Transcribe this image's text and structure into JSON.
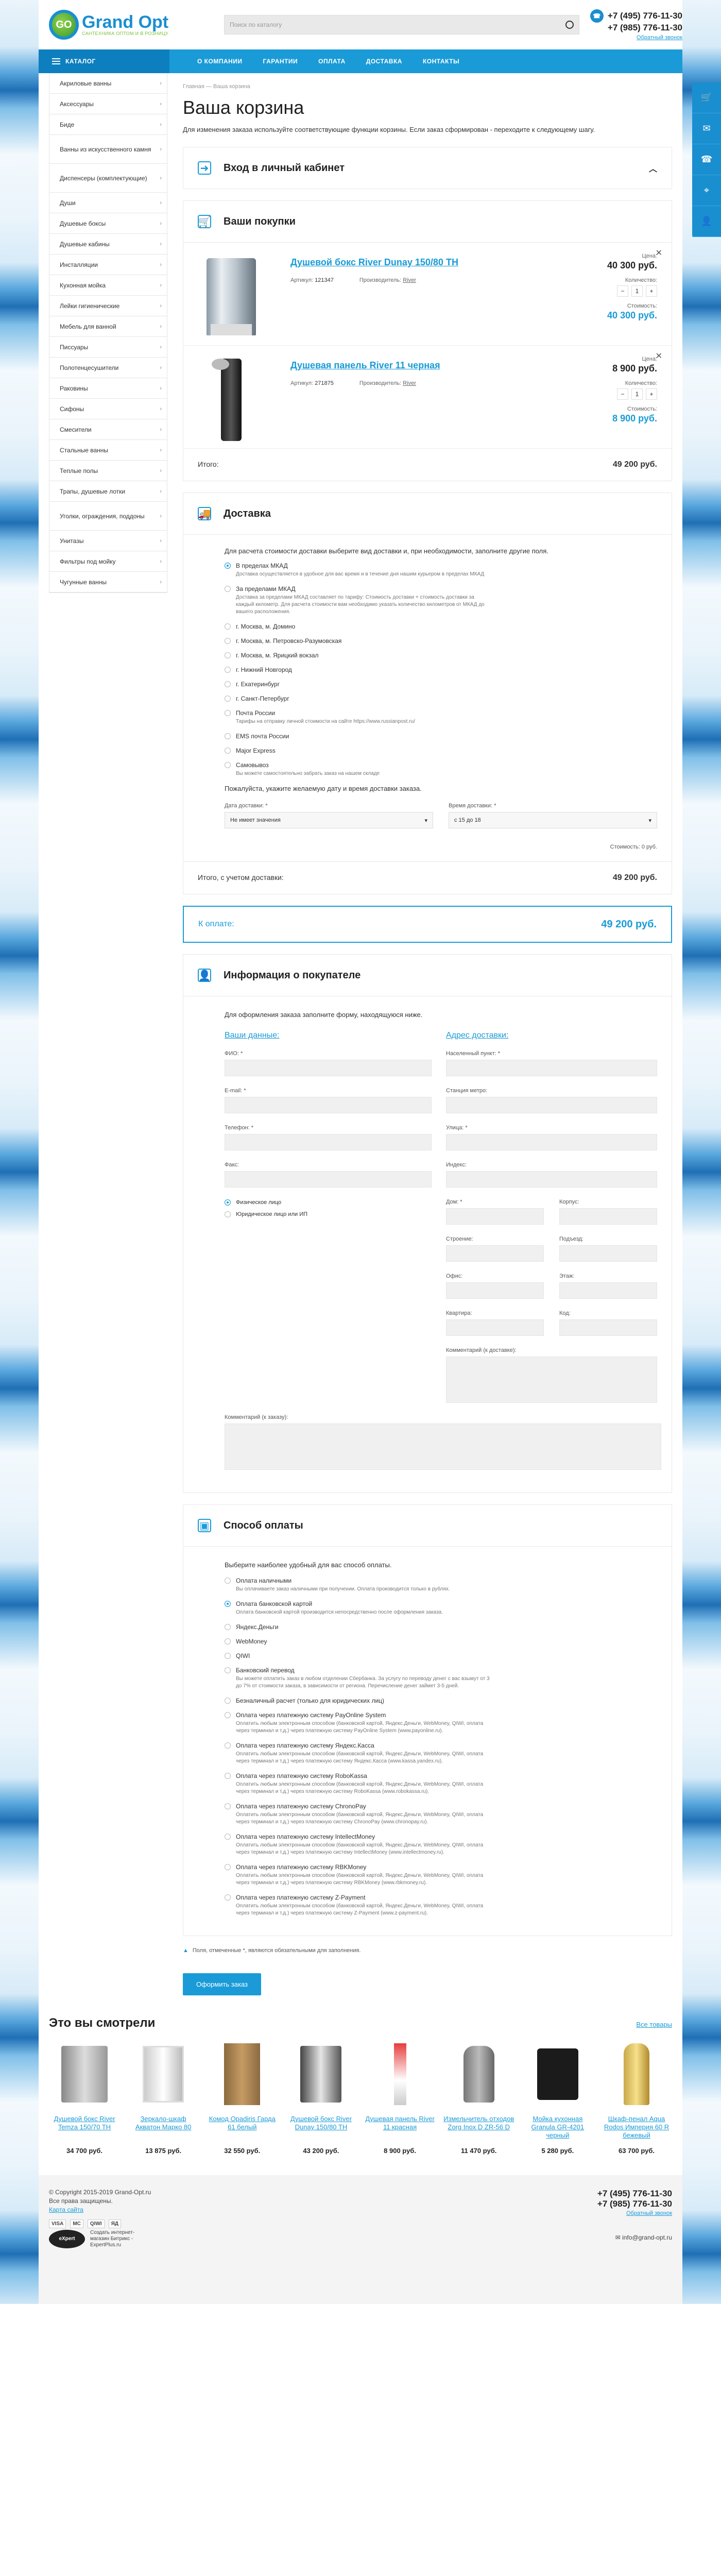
{
  "header": {
    "logo_mark": "GO",
    "logo_name": "Grand Opt",
    "logo_sub": "САНТЕХНИКА ОПТОМ И В РОЗНИЦУ",
    "search_placeholder": "Поиск по каталогу",
    "phone1": "+7 (495) 776-11-30",
    "phone2": "+7 (985) 776-11-30",
    "callback": "Обратный звонок"
  },
  "nav": {
    "catalog": "КАТАЛОГ",
    "items": [
      "О КОМПАНИИ",
      "ГАРАНТИИ",
      "ОПЛАТА",
      "ДОСТАВКА",
      "КОНТАКТЫ"
    ]
  },
  "sidebar": [
    "Акриловые ванны",
    "Аксессуары",
    "Биде",
    "Ванны из искусственного камня",
    "Диспенсеры (комплектующие)",
    "Души",
    "Душевые боксы",
    "Душевые кабины",
    "Инсталляции",
    "Кухонная мойка",
    "Лейки гигиенические",
    "Мебель для ванной",
    "Писсуары",
    "Полотенцесушители",
    "Раковины",
    "Сифоны",
    "Смесители",
    "Стальные ванны",
    "Теплые полы",
    "Трапы, душевые лотки",
    "Уголки, ограждения, поддоны",
    "Унитазы",
    "Фильтры под мойку",
    "Чугунные ванны"
  ],
  "breadcrumb": {
    "home": "Главная",
    "sep": "—",
    "current": "Ваша корзина"
  },
  "page_title": "Ваша корзина",
  "lead": "Для изменения заказа используйте соответствующие функции корзины. Если заказ сформирован - переходите к следующему шагу.",
  "login": {
    "title": "Вход в личный кабинет"
  },
  "cart": {
    "title": "Ваши покупки",
    "items": [
      {
        "name": "Душевой бокс River Dunay 150/80 ТН",
        "article_label": "Артикул:",
        "article": "121347",
        "maker_label": "Производитель:",
        "maker": "River",
        "price_label": "Цена:",
        "price": "40 300 руб.",
        "qty_label": "Количество:",
        "qty": "1",
        "sum_label": "Стоимость:",
        "sum": "40 300 руб."
      },
      {
        "name": "Душевая панель River 11 черная",
        "article_label": "Артикул:",
        "article": "271875",
        "maker_label": "Производитель:",
        "maker": "River",
        "price_label": "Цена:",
        "price": "8 900 руб.",
        "qty_label": "Количество:",
        "qty": "1",
        "sum_label": "Стоимость:",
        "sum": "8 900 руб."
      }
    ],
    "total_label": "Итого:",
    "total": "49 200 руб."
  },
  "delivery": {
    "title": "Доставка",
    "intro": "Для расчета стоимости доставки выберите вид доставки и, при необходимости, заполните другие поля.",
    "options": [
      {
        "t": "В пределах МКАД",
        "d": "Доставка осуществляется в удобное для вас время и в течение дня нашим курьером в пределах МКАД",
        "on": true
      },
      {
        "t": "За пределами МКАД",
        "d": "Доставка за пределами МКАД составляет по тарифу: Стоимость доставки + стоимость доставки за каждый километр. Для расчета стоимости вам необходимо указать количество километров от МКАД до вашего расположения.",
        "on": false
      },
      {
        "t": "г. Москва, м. Домино",
        "d": "",
        "on": false
      },
      {
        "t": "г. Москва, м. Петровско-Разумовская",
        "d": "",
        "on": false
      },
      {
        "t": "г. Москва, м. Ярицкий вокзал",
        "d": "",
        "on": false
      },
      {
        "t": "г. Нижний Новгород",
        "d": "",
        "on": false
      },
      {
        "t": "г. Екатеринбург",
        "d": "",
        "on": false
      },
      {
        "t": "г. Санкт-Петербург",
        "d": "",
        "on": false
      },
      {
        "t": "Почта России",
        "d": "Тарифы на отправку личной стоимости на сайте https://www.russianpost.ru/",
        "on": false
      },
      {
        "t": "EMS почта России",
        "d": "",
        "on": false
      },
      {
        "t": "Major Express",
        "d": "",
        "on": false
      },
      {
        "t": "Самовывоз",
        "d": "Вы можете самостоятельно забрать заказ на нашем складе",
        "on": false
      }
    ],
    "date_hint": "Пожалуйста, укажите желаемую дату и время доставки заказа.",
    "date_label": "Дата доставки: *",
    "date_value": "Не имеет значения",
    "time_label": "Время доставки: *",
    "time_value": "с 15 до 18",
    "cost": "Стоимость: 0 руб.",
    "total_label": "Итого, с учетом доставки:",
    "total": "49 200 руб."
  },
  "topay": {
    "label": "К оплате:",
    "value": "49 200 руб."
  },
  "buyer": {
    "title": "Информация о покупателе",
    "intro": "Для оформления заказа заполните форму, находящуюся ниже.",
    "left_title": "Ваши данные:",
    "right_title": "Адрес доставки:",
    "fio": "ФИО: *",
    "email": "E-mail: *",
    "phone": "Телефон: *",
    "fax": "Факс:",
    "person_phys": "Физическое лицо",
    "person_jur": "Юридическое лицо или ИП",
    "city": "Населенный пункт: *",
    "metro": "Станция метро:",
    "street": "Улица: *",
    "index": "Индекс:",
    "house": "Дом: *",
    "corpus": "Корпус:",
    "building": "Строение:",
    "entrance": "Подъезд:",
    "office": "Офис:",
    "floor": "Этаж:",
    "flat": "Квартира:",
    "code": "Код:",
    "addr_comment": "Комментарий (к доставке):",
    "order_comment": "Комментарий (к заказу):"
  },
  "payment": {
    "title": "Способ оплаты",
    "intro": "Выберите наиболее удобный для вас способ оплаты.",
    "options": [
      {
        "t": "Оплата наличными",
        "d": "Вы оплачиваете заказ наличными при получении. Оплата производится только в рублях.",
        "on": false
      },
      {
        "t": "Оплата банковской картой",
        "d": "Оплата банковской картой производится непосредственно после оформления заказа.",
        "on": true
      },
      {
        "t": "Яндекс.Деньги",
        "d": "",
        "on": false
      },
      {
        "t": "WebMoney",
        "d": "",
        "on": false
      },
      {
        "t": "QIWI",
        "d": "",
        "on": false
      },
      {
        "t": "Банковский перевод",
        "d": "Вы можете оплатить заказ в любом отделении Сбербанка. За услугу по переводу денег с вас взымут от 3 до 7% от стоимости заказа, в зависимости от региона. Перечисление денег займет 3-5 дней.",
        "on": false
      },
      {
        "t": "Безналичный расчет (только для юридических лиц)",
        "d": "",
        "on": false
      },
      {
        "t": "Оплата через платежную систему PayOnline System",
        "d": "Оплатить любым электронным способом (банковской картой, Яндекс.Деньги, WebMoney, QIWI, оплата через терминал и т.д.) через платежную систему PayOnline System (www.payonline.ru).",
        "on": false
      },
      {
        "t": "Оплата через платежную систему Яндекс.Касса",
        "d": "Оплатить любым электронным способом (банковской картой, Яндекс.Деньги, WebMoney, QIWI, оплата через терминал и т.д.) через платежную систему Яндекс.Касса (www.kassa.yandex.ru).",
        "on": false
      },
      {
        "t": "Оплата через платежную систему RoboKassa",
        "d": "Оплатить любым электронным способом (банковской картой, Яндекс.Деньги, WebMoney, QIWI, оплата через терминал и т.д.) через платежную систему RoboKassa (www.robokassa.ru).",
        "on": false
      },
      {
        "t": "Оплата через платежную систему ChronoPay",
        "d": "Оплатить любым электронным способом (банковской картой, Яндекс.Деньги, WebMoney, QIWI, оплата через терминал и т.д.) через платежную систему ChronoPay (www.chronopay.ru).",
        "on": false
      },
      {
        "t": "Оплата через платежную систему IntellectMoney",
        "d": "Оплатить любым электронным способом (банковской картой, Яндекс.Деньги, WebMoney, QIWI, оплата через терминал и т.д.) через платежную систему IntellectMoney (www.intellectmoney.ru).",
        "on": false
      },
      {
        "t": "Оплата через платежную систему RBKMoney",
        "d": "Оплатить любым электронным способом (банковской картой, Яндекс.Деньги, WebMoney, QIWI, оплата через терминал и т.д.) через платежную систему RBKMoney (www.rbkmoney.ru).",
        "on": false
      },
      {
        "t": "Оплата через платежную систему Z-Payment",
        "d": "Оплатить любым электронным способом (банковской картой, Яндекс.Деньги, WebMoney, QIWI, оплата через терминал и т.д.) через платежную систему Z-Payment (www.z-payment.ru).",
        "on": false
      }
    ]
  },
  "note": "Поля, отмеченные *, являются обязательными для заполнения.",
  "submit": "Оформить заказ",
  "recent": {
    "title": "Это вы смотрели",
    "all": "Все товары",
    "items": [
      {
        "name": "Душевой бокс River Temza 150/70 TH",
        "price": "34 700 руб."
      },
      {
        "name": "Зеркало-шкаф Акватон Марко 80",
        "price": "13 875 руб."
      },
      {
        "name": "Комод Opadiris Гарда 61 белый",
        "price": "32 550 руб."
      },
      {
        "name": "Душевой бокс River Dunay 150/80 TH",
        "price": "43 200 руб."
      },
      {
        "name": "Душевая панель River 11 красная",
        "price": "8 900 руб."
      },
      {
        "name": "Измельчитель отходов Zorg Inox D ZR-56 D",
        "price": "11 470 руб."
      },
      {
        "name": "Мойка кухонная Granula GR-4201 черный",
        "price": "5 280 руб."
      },
      {
        "name": "Шкаф-пенал Aqua Rodos Империя 60 R бежевый",
        "price": "63 700 руб."
      }
    ]
  },
  "footer": {
    "copy": "© Copyright 2015-2019 Grand-Opt.ru",
    "rights": "Все права защищены.",
    "sitemap": "Карта сайта",
    "cards": [
      "VISA",
      "MC",
      "QIWI",
      "ЯД"
    ],
    "dev_logo": "eXpert",
    "dev_text1": "Создать интернет-",
    "dev_text2": "магазин Битрикс -",
    "dev_text3": "ExpertPlus.ru",
    "phone1": "+7 (495) 776-11-30",
    "phone2": "+7 (985) 776-11-30",
    "callback": "Обратный звонок",
    "email": "info@grand-opt.ru"
  }
}
